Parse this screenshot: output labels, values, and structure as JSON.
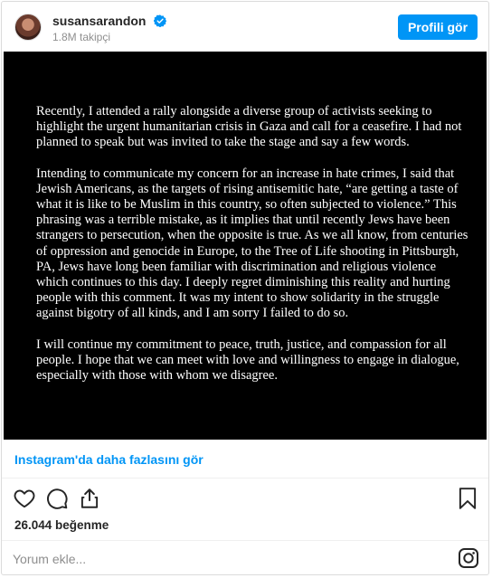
{
  "header": {
    "username": "susansarandon",
    "followers": "1.8M takipçi",
    "profile_button": "Profili gör"
  },
  "post": {
    "paragraphs": [
      "Recently, I attended a rally alongside a diverse group of activists seeking to highlight the urgent humanitarian crisis in Gaza and call for a ceasefire. I had not planned to speak but was invited to take the stage and say a few words.",
      "Intending to communicate my concern for an increase in hate crimes, I said that Jewish Americans, as the targets of rising antisemitic hate, “are getting a taste of what it is like to be Muslim in this country, so often subjected to violence.” This phrasing was a terrible mistake, as it implies that until recently Jews have been strangers to persecution, when the opposite is true. As we all know, from centuries of oppression and genocide in Europe, to the Tree of Life shooting in Pittsburgh, PA, Jews have long been familiar with discrimination and religious violence which continues to this day. I deeply regret diminishing this reality and hurting people with this comment. It was my intent to show solidarity in the struggle against bigotry of all kinds, and I am sorry I failed to do so.",
      "I will continue my commitment to peace, truth, justice, and compassion for all people. I hope that we can meet with love and willingness to engage in dialogue, especially with those with whom we disagree."
    ]
  },
  "more_link": "Instagram'da daha fazlasını gör",
  "likes": "26.044 beğenme",
  "comment": {
    "placeholder": "Yorum ekle..."
  },
  "icons": {
    "like": "heart-icon",
    "comment": "comment-icon",
    "share": "share-icon",
    "save": "bookmark-icon",
    "logo": "instagram-icon",
    "verified": "verified-badge-icon"
  },
  "colors": {
    "accent": "#0095f6",
    "media_background": "#000000"
  }
}
